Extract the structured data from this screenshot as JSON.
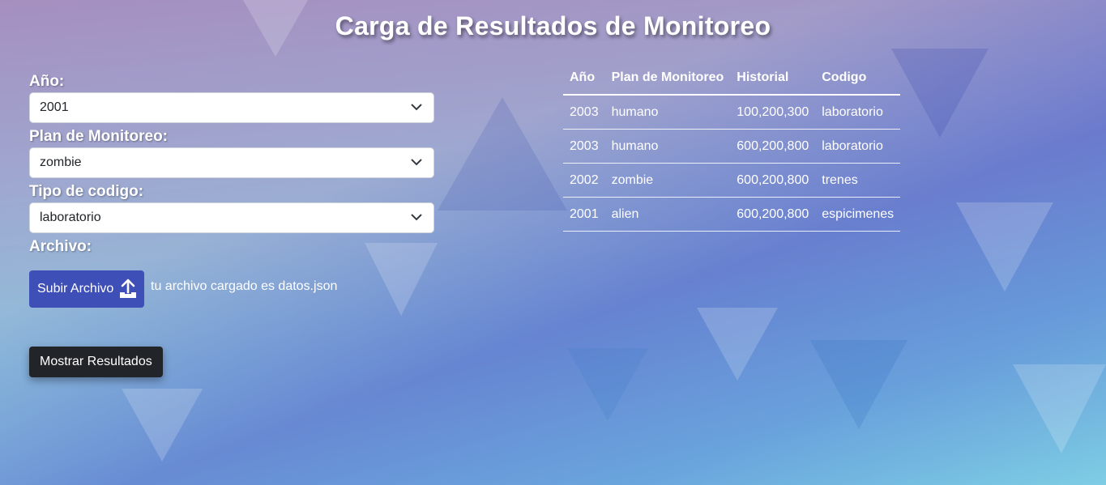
{
  "title": "Carga de Resultados de Monitoreo",
  "form": {
    "year_label": "Año:",
    "year_value": "2001",
    "plan_label": "Plan de Monitoreo:",
    "plan_value": "zombie",
    "code_label": "Tipo de codigo:",
    "code_value": "laboratorio",
    "file_label": "Archivo:",
    "upload_button": "Subir Archivo",
    "upload_icon": "upload-icon",
    "file_status": "tu archivo cargado es datos.json",
    "show_button": "Mostrar Resultados"
  },
  "table": {
    "headers": [
      "Año",
      "Plan de Monitoreo",
      "Historial",
      "Codigo"
    ],
    "rows": [
      [
        "2003",
        "humano",
        "100,200,300",
        "laboratorio"
      ],
      [
        "2003",
        "humano",
        "600,200,800",
        "laboratorio"
      ],
      [
        "2002",
        "zombie",
        "600,200,800",
        "trenes"
      ],
      [
        "2001",
        "alien",
        "600,200,800",
        "espicimenes"
      ]
    ]
  },
  "colors": {
    "upload_button": "#3f4fb8",
    "show_button": "#212529",
    "text": "#ffffff"
  }
}
